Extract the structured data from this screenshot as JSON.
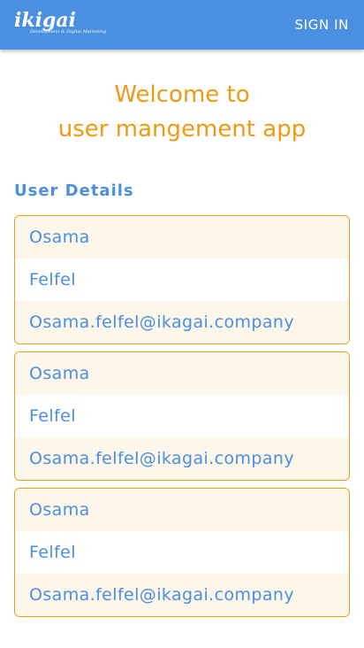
{
  "header": {
    "logo_word": "ikigai",
    "logo_tagline": "Development & Digital Marketing",
    "signin_label": "SIGN IN",
    "bar_color": "#4a8fe0"
  },
  "welcome": {
    "line1": "Welcome to",
    "line2": "user mangement app",
    "color": "#ef9a12"
  },
  "section": {
    "title": "User Details"
  },
  "users": [
    {
      "first_name": "Osama",
      "last_name": "Felfel",
      "email": "Osama.felfel@ikagai.company"
    },
    {
      "first_name": "Osama",
      "last_name": "Felfel",
      "email": "Osama.felfel@ikagai.company"
    },
    {
      "first_name": "Osama",
      "last_name": "Felfel",
      "email": "Osama.felfel@ikagai.company"
    }
  ]
}
